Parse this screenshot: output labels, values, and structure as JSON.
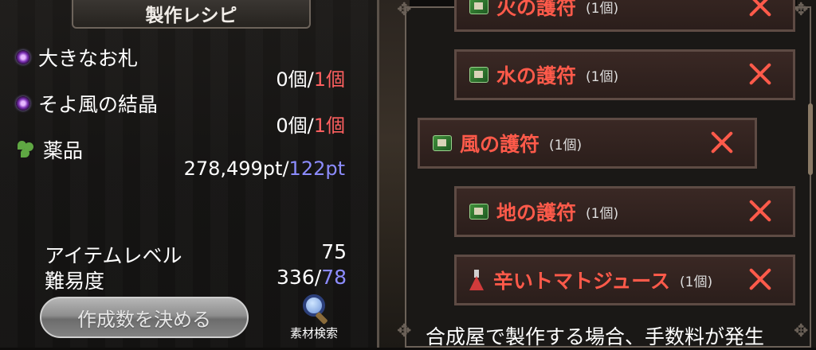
{
  "recipe": {
    "title": "製作レシピ",
    "materials": [
      {
        "name": "大きなお札",
        "have": "0個",
        "sep": "/",
        "need": "1個",
        "icon": "orb-icon"
      },
      {
        "name": "そよ風の結晶",
        "have": "0個",
        "sep": "/",
        "need": "1個",
        "icon": "orb-icon"
      },
      {
        "name": "薬品",
        "have": "278,499pt",
        "sep": "/",
        "need": "122pt",
        "icon": "herb-icon"
      }
    ],
    "item_level_label": "アイテムレベル",
    "item_level_value": "75",
    "difficulty_label": "難易度",
    "difficulty_have": "336",
    "difficulty_sep": "/",
    "difficulty_need": "78",
    "make_button": "作成数を決める",
    "search_label": "素材検索"
  },
  "list": {
    "items": [
      {
        "name": "火の護符",
        "count": "(1個)"
      },
      {
        "name": "水の護符",
        "count": "(1個)"
      },
      {
        "name": "風の護符",
        "count": "(1個)"
      },
      {
        "name": "地の護符",
        "count": "(1個)"
      },
      {
        "name": "辛いトマトジュース",
        "count": "(1個)"
      }
    ],
    "footer_note": "合成屋で製作する場合、手数料が発生"
  },
  "colors": {
    "required_red": "#ff6060",
    "points_blue": "#8c8cff",
    "item_name_red": "#ff5a4a"
  }
}
